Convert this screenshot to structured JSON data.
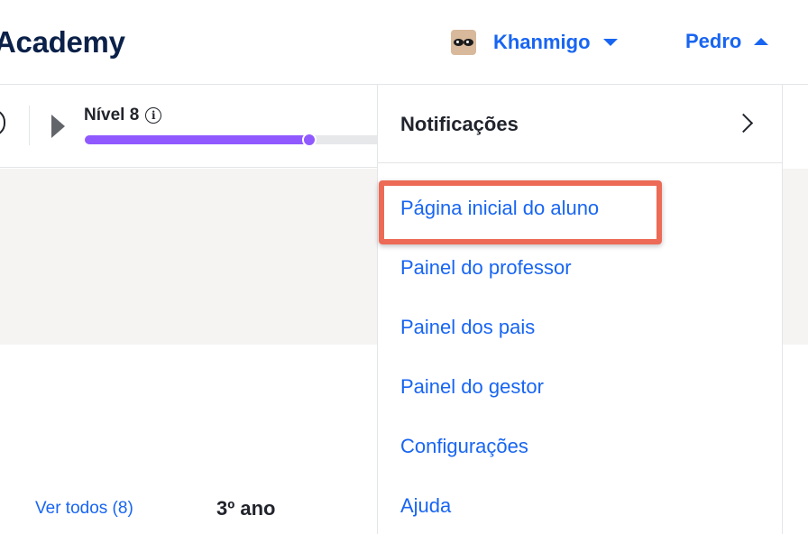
{
  "header": {
    "logo_text": "Academy",
    "khanmigo_label": "Khanmigo",
    "user_name": "Pedro"
  },
  "level": {
    "title": "Nível 8",
    "progress_fraction": 0.77
  },
  "dropdown": {
    "notifications_label": "Notificações",
    "items": [
      {
        "label": "Página inicial do aluno",
        "highlighted": true
      },
      {
        "label": "Painel do professor"
      },
      {
        "label": "Painel dos pais"
      },
      {
        "label": "Painel do gestor"
      },
      {
        "label": "Configurações"
      },
      {
        "label": "Ajuda"
      }
    ]
  },
  "content": {
    "view_all_label": "Ver todos (8)",
    "grade_label": "3º ano"
  },
  "colors": {
    "link": "#1865f2",
    "progress": "#9059ff",
    "highlight": "#ec6a56",
    "logo": "#0b2149"
  },
  "icons": [
    "khanmigo-avatar-icon",
    "chevron-down-icon",
    "chevron-up-icon",
    "play-icon",
    "info-icon",
    "chevron-right-icon"
  ]
}
